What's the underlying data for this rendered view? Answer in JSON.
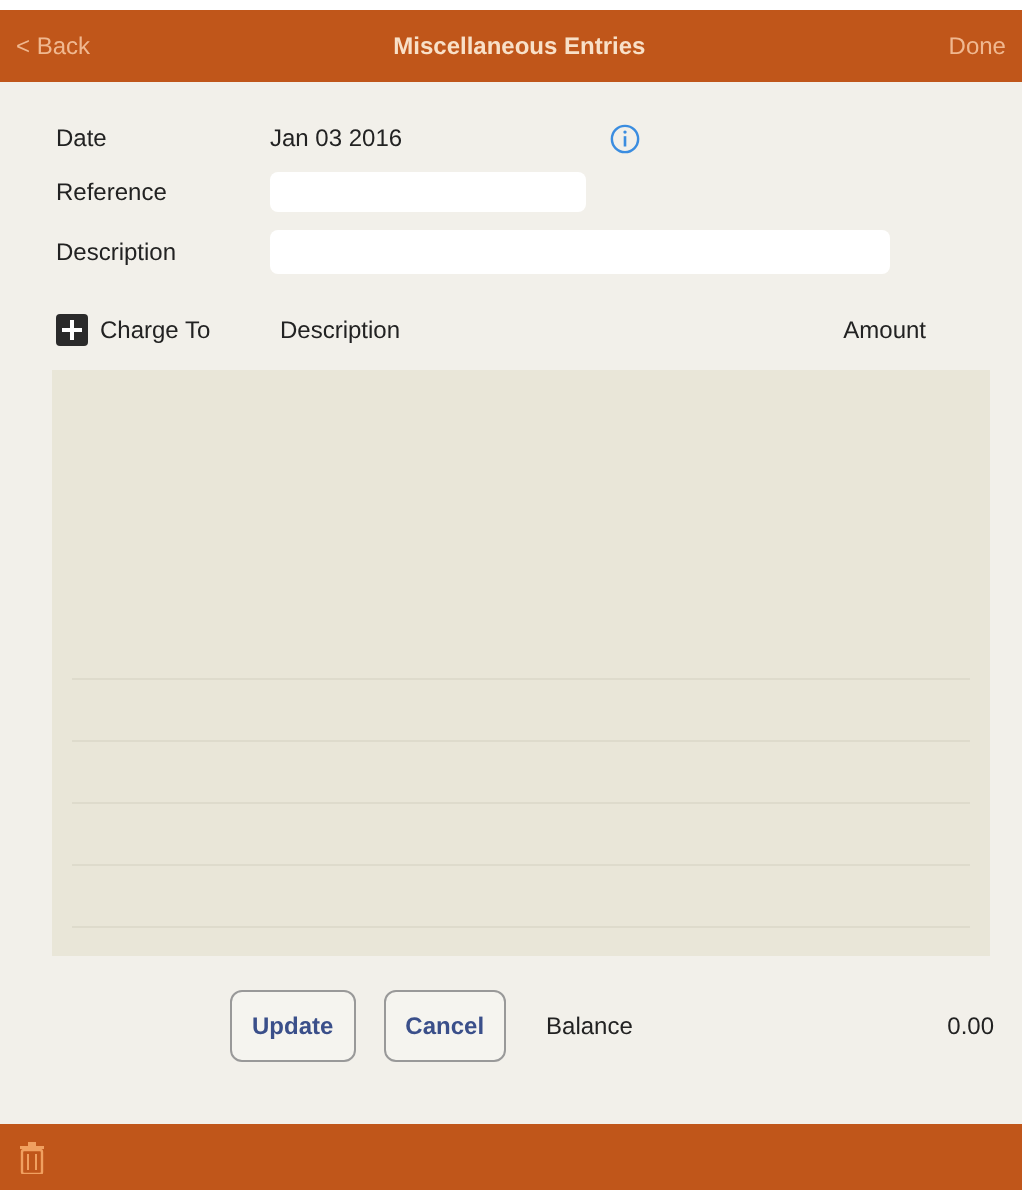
{
  "nav_bar": {
    "back": "< Back",
    "title": "Miscellaneous Entries",
    "done": "Done"
  },
  "form": {
    "date_label": "Date",
    "date_value": "Jan 03 2016",
    "reference_label": "Reference",
    "description_label": "Description"
  },
  "table": {
    "columns": [
      "Charge To",
      "Description",
      "Amount"
    ]
  },
  "buttons": [
    "Update",
    "Cancel"
  ],
  "balance": {
    "label": "Balance",
    "value": "0.00"
  }
}
